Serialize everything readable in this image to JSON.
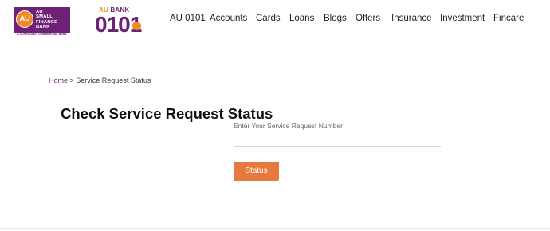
{
  "header": {
    "au_logo": {
      "badge": "AU",
      "words": [
        "AU",
        "SMALL",
        "FINANCE",
        "BANK"
      ],
      "tagline": "A SCHEDULED COMMERCIAL BANK"
    },
    "bank_logo": {
      "small_left": "AU",
      "small_right": "BANK",
      "big": "0101"
    },
    "nav": [
      {
        "label": "AU 0101"
      },
      {
        "label": "Accounts"
      },
      {
        "label": "Cards"
      },
      {
        "label": "Loans"
      },
      {
        "label": "Blogs"
      },
      {
        "label": "Offers"
      },
      {
        "label": "Insurance"
      },
      {
        "label": "Investment"
      },
      {
        "label": "Fincare"
      }
    ]
  },
  "breadcrumb": {
    "home": "Home",
    "separator": " > ",
    "current": "Service Request Status"
  },
  "main": {
    "title": "Check Service Request Status",
    "input_label": "Enter Your Service Request Number",
    "input_value": "",
    "button_label": "Status"
  },
  "colors": {
    "brand_purple": "#6d2177",
    "brand_orange": "#f08a24",
    "button": "#e8793e"
  }
}
